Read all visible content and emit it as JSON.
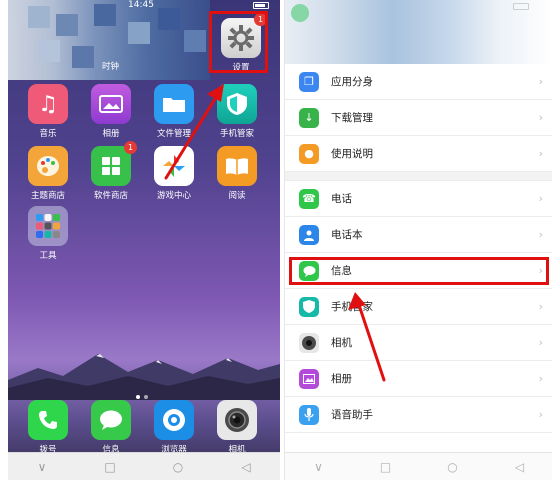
{
  "left_screen": {
    "status_time": "14:45",
    "home_apps": [
      {
        "label": "音乐",
        "icon": "music-icon",
        "color": "#ef5a78"
      },
      {
        "label": "相册",
        "icon": "gallery-icon",
        "color": "#b44ad9"
      },
      {
        "label": "文件管理",
        "icon": "folder-icon",
        "color": "#2d9cf0"
      },
      {
        "label": "手机管家",
        "icon": "shield-icon",
        "color": "#16b8a8"
      },
      {
        "label": "主题商店",
        "icon": "palette-icon",
        "color": "#f3a53a"
      },
      {
        "label": "软件商店",
        "icon": "app-store-icon",
        "color": "#37c14a"
      },
      {
        "label": "游戏中心",
        "icon": "game-center-icon",
        "color": "#ffffff"
      },
      {
        "label": "阅读",
        "icon": "book-icon",
        "color": "#f39b25"
      },
      {
        "label": "工具",
        "icon": "tools-folder-icon",
        "color": "#9a9ab8"
      }
    ],
    "blurred_label": "时钟",
    "settings": {
      "label": "设置",
      "badge": "1"
    },
    "software_store_badge": "1",
    "dock_apps": [
      {
        "label": "拨号",
        "icon": "phone-icon",
        "color": "#2fd54a"
      },
      {
        "label": "信息",
        "icon": "message-icon",
        "color": "#36c94a"
      },
      {
        "label": "浏览器",
        "icon": "browser-icon",
        "color": "#1d8ee6"
      },
      {
        "label": "相机",
        "icon": "camera-icon",
        "color": "#e8e8e8"
      }
    ],
    "nav": {
      "back": "∨",
      "home": "□",
      "recent": "○",
      "menu": "◁"
    }
  },
  "right_screen": {
    "group1": [
      {
        "label": "应用分身",
        "icon": "clone-icon",
        "color": "#3b86f0"
      },
      {
        "label": "下载管理",
        "icon": "download-icon",
        "color": "#38b34a"
      },
      {
        "label": "使用说明",
        "icon": "bulb-icon",
        "color": "#f39b25"
      }
    ],
    "group2": [
      {
        "label": "电话",
        "icon": "phone-icon",
        "color": "#2fc649"
      },
      {
        "label": "电话本",
        "icon": "contacts-icon",
        "color": "#2c86ea"
      },
      {
        "label": "信息",
        "icon": "message-icon",
        "color": "#2fc649"
      },
      {
        "label": "手机管家",
        "icon": "shield-icon",
        "color": "#16b8a8"
      },
      {
        "label": "相机",
        "icon": "camera-icon",
        "color": "#7d7d7d"
      },
      {
        "label": "相册",
        "icon": "gallery-icon",
        "color": "#b44ad9"
      },
      {
        "label": "语音助手",
        "icon": "mic-icon",
        "color": "#3aa0f0"
      }
    ],
    "chevron": "›",
    "nav": {
      "back": "∨",
      "home": "□",
      "recent": "○",
      "menu": "◁"
    }
  }
}
